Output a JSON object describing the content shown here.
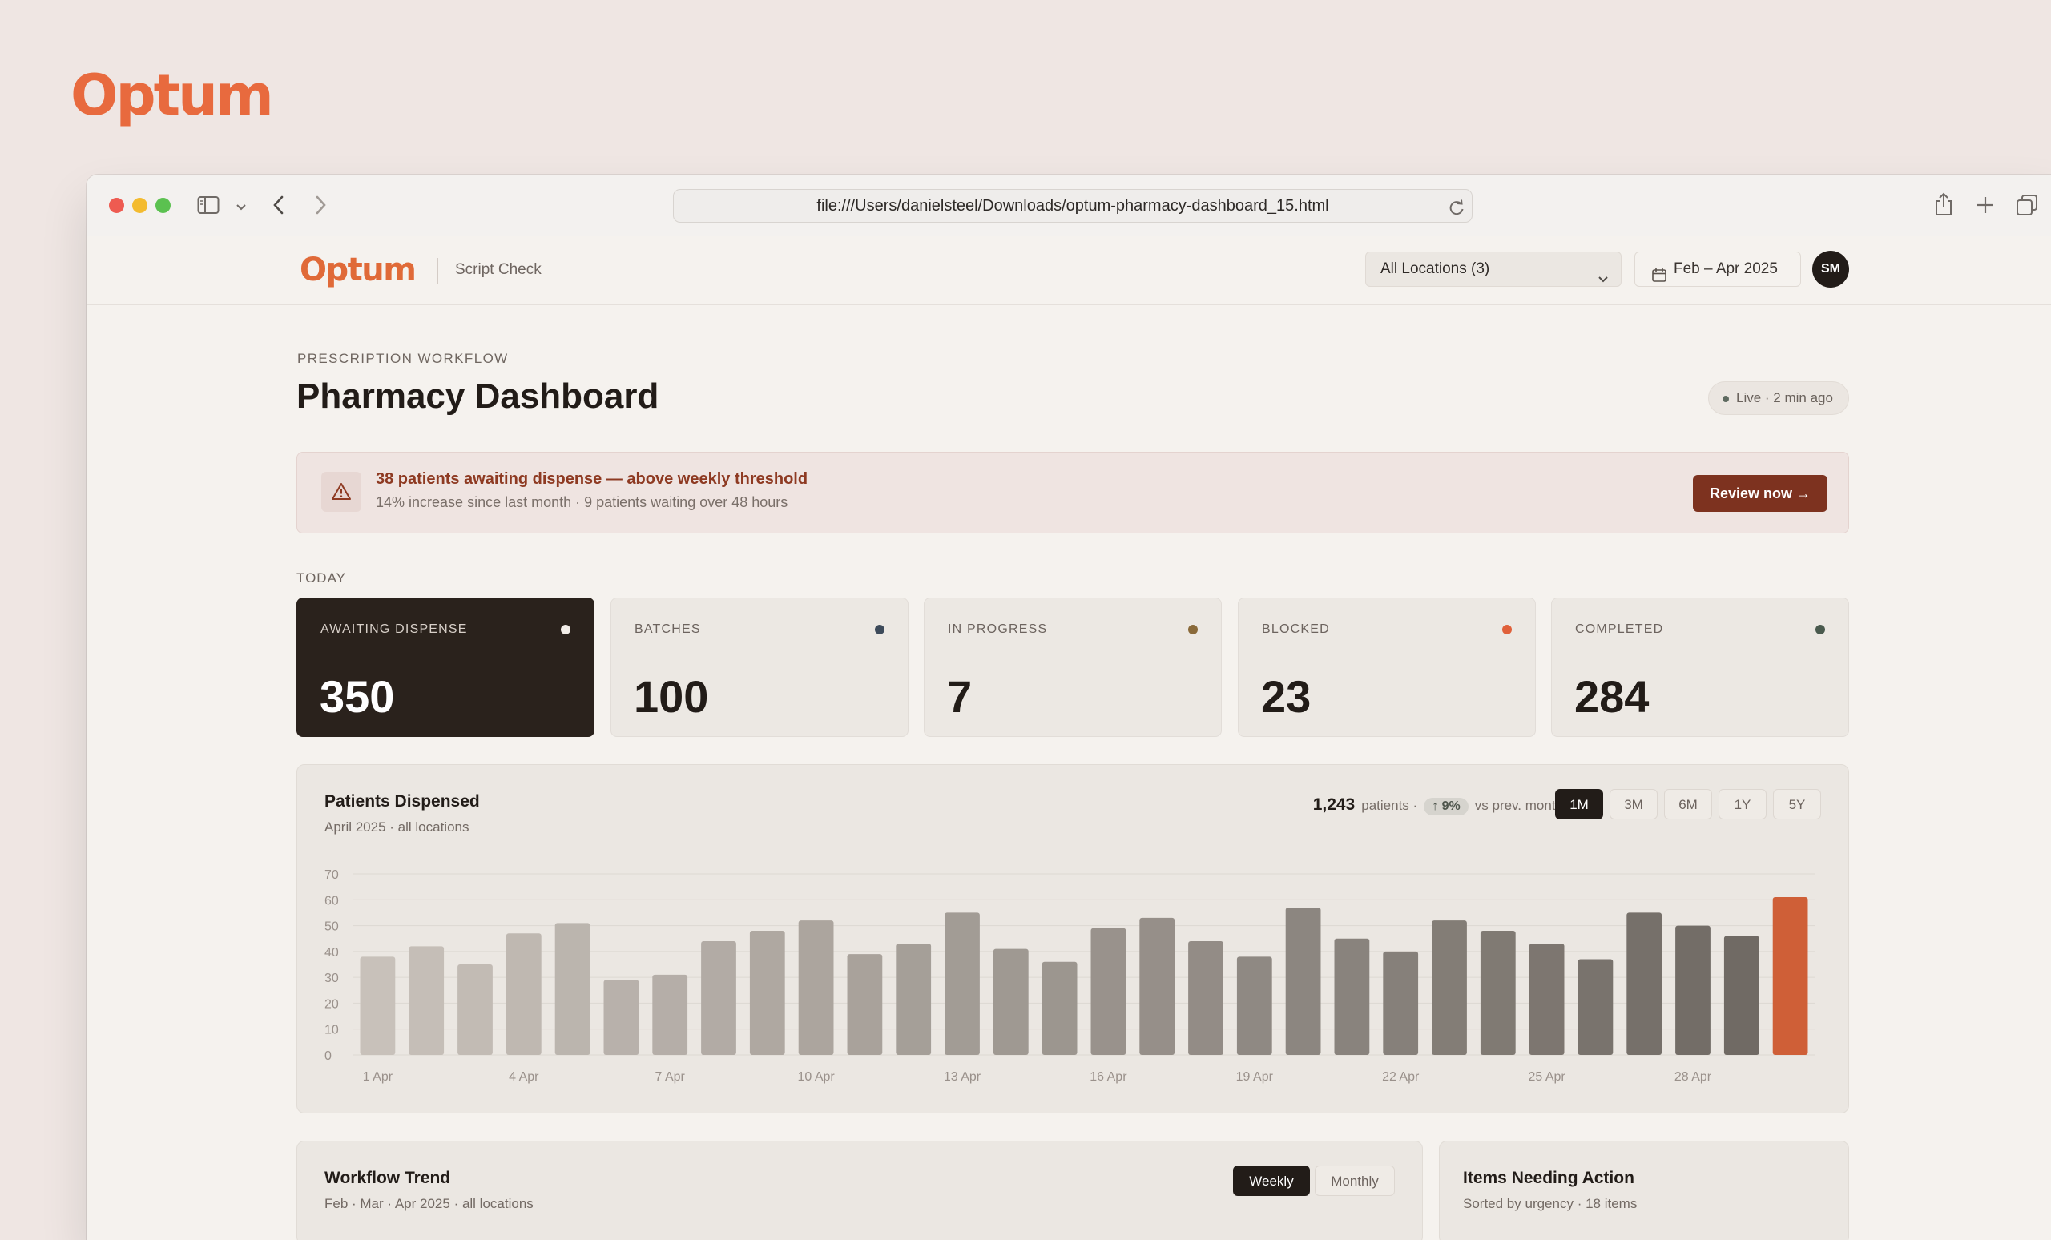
{
  "brand": {
    "logo_text": "Optum"
  },
  "browser": {
    "url": "file:///Users/danielsteel/Downloads/optum-pharmacy-dashboard_15.html",
    "icons": [
      "sidebar-icon",
      "chevron-down-icon",
      "back-icon",
      "forward-icon",
      "reload-icon",
      "share-icon",
      "new-tab-icon",
      "tabs-overview-icon"
    ]
  },
  "app": {
    "logo": "Optum",
    "product": "Script Check",
    "location_filter": "All Locations (3)",
    "date_range": "Feb – Apr 2025",
    "avatar_initials": "SM"
  },
  "page": {
    "eyebrow": "PRESCRIPTION WORKFLOW",
    "title": "Pharmacy Dashboard",
    "live_status": "Live · 2 min ago"
  },
  "alert": {
    "title": "38 patients awaiting dispense — above weekly threshold",
    "subtitle": "14% increase since last month · 9 patients waiting over 48 hours",
    "action": "Review now →"
  },
  "today": {
    "label": "TODAY",
    "cards": [
      {
        "label": "AWAITING DISPENSE",
        "value": "350",
        "dot_color": "#f2ede8"
      },
      {
        "label": "BATCHES",
        "value": "100",
        "dot_color": "#3d4a5a"
      },
      {
        "label": "IN PROGRESS",
        "value": "7",
        "dot_color": "#8a6a3a"
      },
      {
        "label": "BLOCKED",
        "value": "23",
        "dot_color": "#e0603a"
      },
      {
        "label": "COMPLETED",
        "value": "284",
        "dot_color": "#4a5a4e"
      }
    ]
  },
  "dispensed": {
    "title": "Patients Dispensed",
    "subtitle": "April 2025 · all locations",
    "total": "1,243",
    "total_unit": "patients ·",
    "change": "↑ 9%",
    "change_suffix": "vs prev. month",
    "ranges": [
      "1M",
      "3M",
      "6M",
      "1Y",
      "5Y"
    ],
    "active_range": "1M"
  },
  "chart_data": {
    "type": "bar",
    "categories": [
      "1 Apr",
      "2 Apr",
      "3 Apr",
      "4 Apr",
      "5 Apr",
      "6 Apr",
      "7 Apr",
      "8 Apr",
      "9 Apr",
      "10 Apr",
      "11 Apr",
      "12 Apr",
      "13 Apr",
      "14 Apr",
      "15 Apr",
      "16 Apr",
      "17 Apr",
      "18 Apr",
      "19 Apr",
      "20 Apr",
      "21 Apr",
      "22 Apr",
      "23 Apr",
      "24 Apr",
      "25 Apr",
      "26 Apr",
      "27 Apr",
      "28 Apr",
      "29 Apr",
      "30 Apr"
    ],
    "x_tick_labels": [
      "1 Apr",
      "4 Apr",
      "7 Apr",
      "10 Apr",
      "13 Apr",
      "16 Apr",
      "19 Apr",
      "22 Apr",
      "25 Apr",
      "28 Apr"
    ],
    "values": [
      38,
      42,
      35,
      47,
      51,
      29,
      31,
      44,
      48,
      52,
      39,
      43,
      55,
      41,
      36,
      49,
      53,
      44,
      38,
      57,
      45,
      40,
      52,
      48,
      43,
      37,
      55,
      50,
      46,
      61
    ],
    "ylim": [
      0,
      70
    ],
    "y_ticks": [
      0,
      10,
      20,
      30,
      40,
      50,
      60,
      70
    ],
    "highlight_last": true,
    "highlight_color": "#cf5f37",
    "grid": true
  },
  "workflow": {
    "title": "Workflow Trend",
    "subtitle": "Feb · Mar · Apr 2025 · all locations",
    "toggle": [
      "Weekly",
      "Monthly"
    ],
    "active": "Weekly"
  },
  "action_items": {
    "title": "Items Needing Action",
    "subtitle": "Sorted by urgency · 18 items"
  }
}
